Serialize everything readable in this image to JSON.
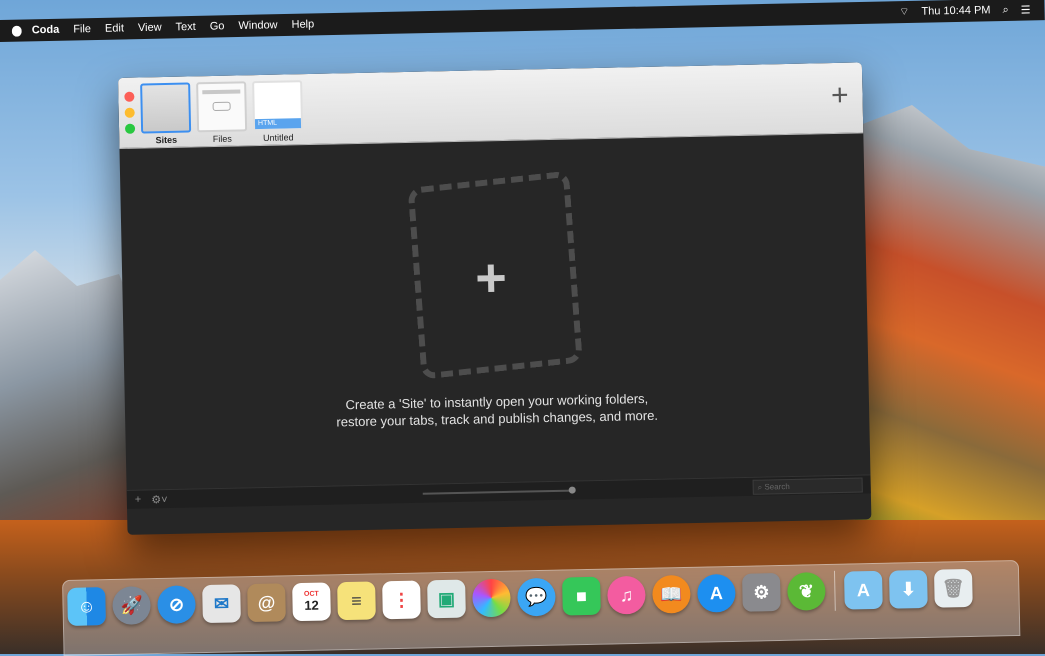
{
  "menubar": {
    "app": "Coda",
    "items": [
      "File",
      "Edit",
      "View",
      "Text",
      "Go",
      "Window",
      "Help"
    ],
    "clock": "Thu 10:44 PM"
  },
  "window": {
    "tabs": [
      {
        "label": "Sites",
        "active": true
      },
      {
        "label": "Files",
        "active": false
      },
      {
        "label": "Untitled",
        "active": false,
        "badge": "HTML"
      }
    ],
    "message_line1": "Create a 'Site' to instantly open your working folders,",
    "message_line2": "restore your tabs, track and publish changes, and more.",
    "search_placeholder": "Search"
  },
  "dock": {
    "icons": [
      "finder-icon",
      "launchpad-icon",
      "safari-icon",
      "mail-icon",
      "contacts-icon",
      "calendar-icon",
      "notes-icon",
      "reminders-icon",
      "preview-icon",
      "photos-icon",
      "messages-icon",
      "facetime-icon",
      "itunes-icon",
      "ibooks-icon",
      "app-store-icon",
      "system-preferences-icon",
      "coda-icon",
      "applications-folder-icon",
      "downloads-folder-icon",
      "trash-icon"
    ],
    "calendar": {
      "month": "OCT",
      "day": "12"
    }
  }
}
